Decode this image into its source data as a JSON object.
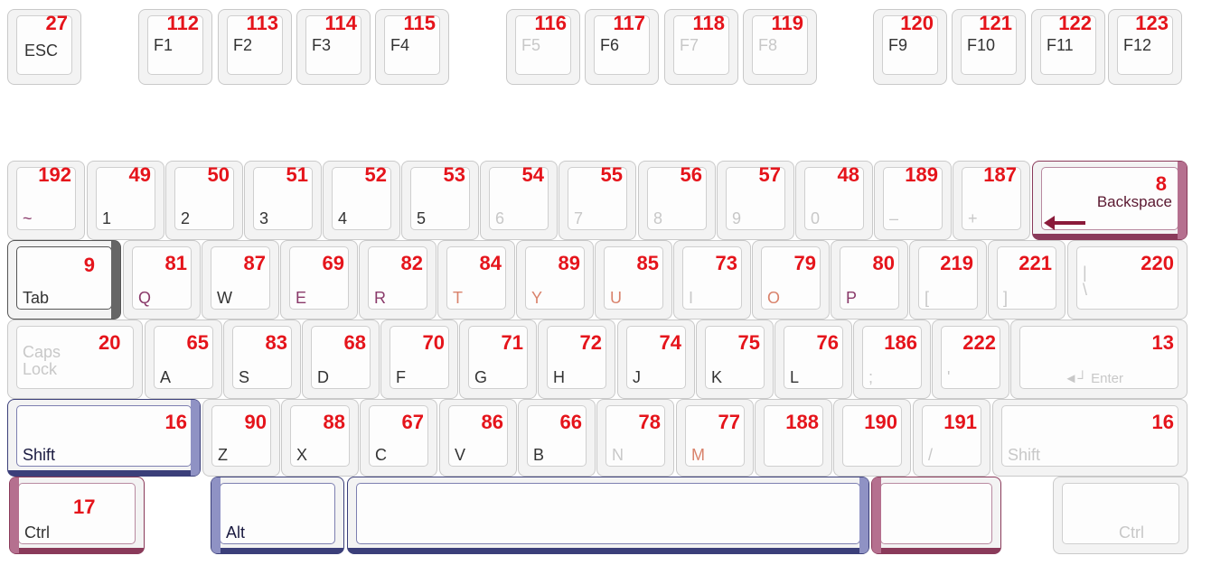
{
  "keys": [
    {
      "id": "esc",
      "label": "ESC",
      "code": "27"
    },
    {
      "id": "f1",
      "label": "F1",
      "code": "112"
    },
    {
      "id": "f2",
      "label": "F2",
      "code": "113"
    },
    {
      "id": "f3",
      "label": "F3",
      "code": "114"
    },
    {
      "id": "f4",
      "label": "F4",
      "code": "115"
    },
    {
      "id": "f5",
      "label": "F5",
      "code": "116"
    },
    {
      "id": "f6",
      "label": "F6",
      "code": "117"
    },
    {
      "id": "f7",
      "label": "F7",
      "code": "118"
    },
    {
      "id": "f8",
      "label": "F8",
      "code": "119"
    },
    {
      "id": "f9",
      "label": "F9",
      "code": "120"
    },
    {
      "id": "f10",
      "label": "F10",
      "code": "121"
    },
    {
      "id": "f11",
      "label": "F11",
      "code": "122"
    },
    {
      "id": "f12",
      "label": "F12",
      "code": "123"
    },
    {
      "id": "tilde",
      "label": "~",
      "code": "192"
    },
    {
      "id": "k1",
      "label": "1",
      "code": "49"
    },
    {
      "id": "k2",
      "label": "2",
      "code": "50"
    },
    {
      "id": "k3",
      "label": "3",
      "code": "51"
    },
    {
      "id": "k4",
      "label": "4",
      "code": "52"
    },
    {
      "id": "k5",
      "label": "5",
      "code": "53"
    },
    {
      "id": "k6",
      "label": "6",
      "code": "54"
    },
    {
      "id": "k7",
      "label": "7",
      "code": "55"
    },
    {
      "id": "k8",
      "label": "8",
      "code": "56"
    },
    {
      "id": "k9",
      "label": "9",
      "code": "57"
    },
    {
      "id": "k0",
      "label": "0",
      "code": "48"
    },
    {
      "id": "minus",
      "label": "–",
      "code": "189"
    },
    {
      "id": "plus",
      "label": "+",
      "code": "187"
    },
    {
      "id": "backspace",
      "label": "Backspace",
      "code": "8"
    },
    {
      "id": "tab",
      "label": "Tab",
      "code": "9"
    },
    {
      "id": "q",
      "label": "Q",
      "code": "81"
    },
    {
      "id": "w",
      "label": "W",
      "code": "87"
    },
    {
      "id": "e",
      "label": "E",
      "code": "69"
    },
    {
      "id": "r",
      "label": "R",
      "code": "82"
    },
    {
      "id": "t",
      "label": "T",
      "code": "84"
    },
    {
      "id": "y",
      "label": "Y",
      "code": "89"
    },
    {
      "id": "u",
      "label": "U",
      "code": "85"
    },
    {
      "id": "i",
      "label": "I",
      "code": "73"
    },
    {
      "id": "o",
      "label": "O",
      "code": "79"
    },
    {
      "id": "p",
      "label": "P",
      "code": "80"
    },
    {
      "id": "lbracket",
      "label": "[",
      "code": "219"
    },
    {
      "id": "rbracket",
      "label": "]",
      "code": "221"
    },
    {
      "id": "backslash",
      "label": "|\n\\",
      "code": "220"
    },
    {
      "id": "caps",
      "label": "Caps\nLock",
      "code": "20"
    },
    {
      "id": "a",
      "label": "A",
      "code": "65"
    },
    {
      "id": "s",
      "label": "S",
      "code": "83"
    },
    {
      "id": "d",
      "label": "D",
      "code": "68"
    },
    {
      "id": "f",
      "label": "F",
      "code": "70"
    },
    {
      "id": "g",
      "label": "G",
      "code": "71"
    },
    {
      "id": "h",
      "label": "H",
      "code": "72"
    },
    {
      "id": "j",
      "label": "J",
      "code": "74"
    },
    {
      "id": "k",
      "label": "K",
      "code": "75"
    },
    {
      "id": "l",
      "label": "L",
      "code": "76"
    },
    {
      "id": "semicolon",
      "label": ";",
      "code": "186"
    },
    {
      "id": "quote",
      "label": "'",
      "code": "222"
    },
    {
      "id": "enter",
      "label": "◄┘ Enter",
      "code": "13"
    },
    {
      "id": "lshift",
      "label": "Shift",
      "code": "16"
    },
    {
      "id": "z",
      "label": "Z",
      "code": "90"
    },
    {
      "id": "x",
      "label": "X",
      "code": "88"
    },
    {
      "id": "c",
      "label": "C",
      "code": "67"
    },
    {
      "id": "v",
      "label": "V",
      "code": "86"
    },
    {
      "id": "b",
      "label": "B",
      "code": "66"
    },
    {
      "id": "n",
      "label": "N",
      "code": "78"
    },
    {
      "id": "m",
      "label": "M",
      "code": "77"
    },
    {
      "id": "comma",
      "label": "",
      "code": "188"
    },
    {
      "id": "period",
      "label": "",
      "code": "190"
    },
    {
      "id": "slash",
      "label": "/",
      "code": "191"
    },
    {
      "id": "rshift",
      "label": "Shift",
      "code": "16"
    },
    {
      "id": "lctrl",
      "label": "Ctrl",
      "code": "17"
    },
    {
      "id": "alt",
      "label": "Alt",
      "code": ""
    },
    {
      "id": "space",
      "label": "",
      "code": ""
    },
    {
      "id": "ralt",
      "label": "",
      "code": ""
    },
    {
      "id": "rctrl",
      "label": "Ctrl",
      "code": ""
    }
  ],
  "colors": {
    "code": "#e5141b",
    "navy": "#3b3f7a",
    "maroon": "#8a3a5a"
  }
}
